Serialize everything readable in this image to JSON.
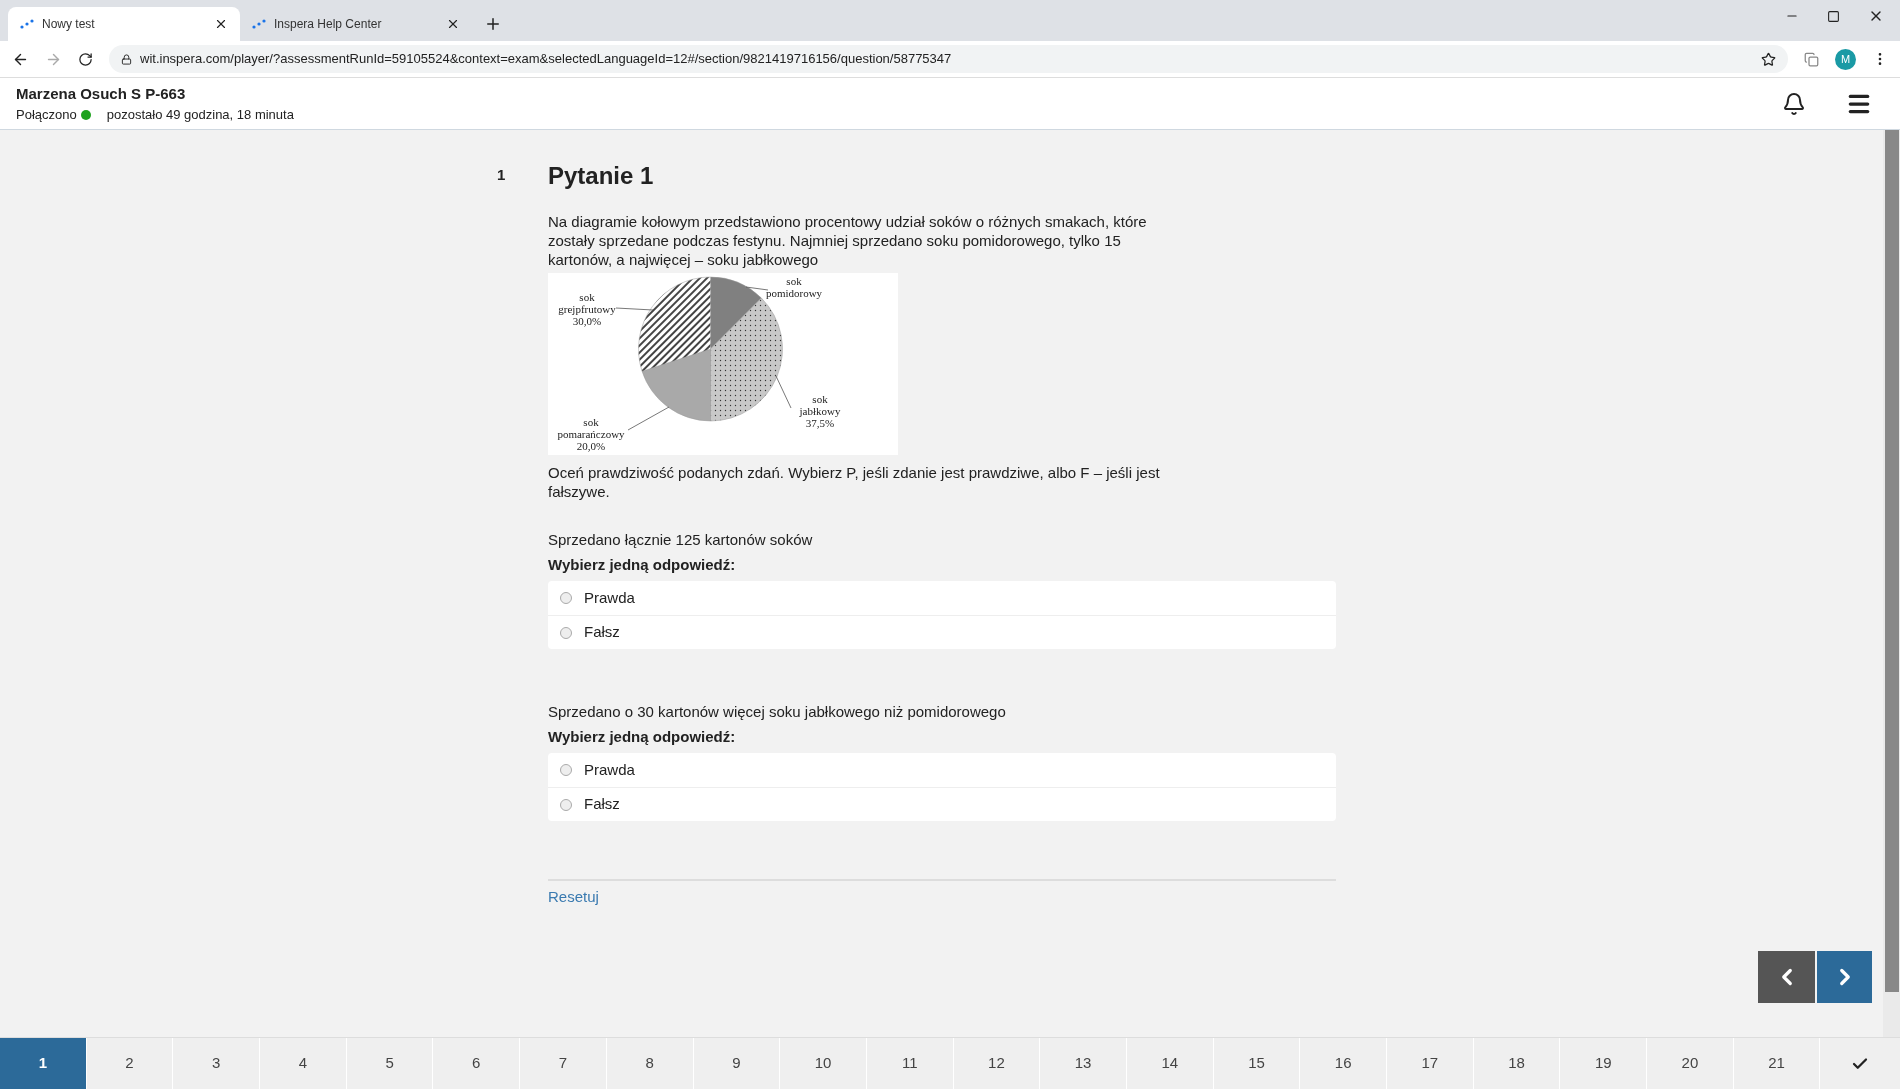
{
  "browser": {
    "tabs": [
      {
        "title": "Nowy test",
        "selected": true
      },
      {
        "title": "Inspera Help Center",
        "selected": false
      }
    ],
    "address": "wit.inspera.com/player/?assessmentRunId=59105524&context=exam&selectedLanguageId=12#/section/9821419716156/question/58775347",
    "profile_initial": "M"
  },
  "header": {
    "candidate": "Marzena Osuch S P-663",
    "connection": "Połączono",
    "connected": true,
    "time_left": "pozostało 49 godzina, 18 minuta"
  },
  "question": {
    "number": "1",
    "title": "Pytanie 1",
    "intro": "Na diagramie kołowym przedstawiono procentowy udział soków o różnych smakach, które zostały sprzedane podczas festynu. Najmniej sprzedano soku pomidorowego, tylko 15 kartonów, a najwięcej – soku jabłkowego",
    "chart_data": {
      "type": "pie",
      "categories": [
        "sok pomidorowy",
        "sok jabłkowy",
        "sok pomarańczowy",
        "sok grejpfrutowy"
      ],
      "values": [
        12.5,
        37.5,
        20,
        30
      ],
      "value_labels": [
        null,
        "37,5%",
        "20,0%",
        "30,0%"
      ]
    },
    "instruction": "Oceń prawdziwość podanych zdań. Wybierz P, jeśli zdanie jest prawdziwe, albo F – jeśli jest fałszywe.",
    "statements": [
      {
        "text": "Sprzedano łącznie 125 kartonów soków",
        "prompt": "Wybierz jedną odpowiedź:",
        "options": [
          {
            "label": "Prawda",
            "selected": false
          },
          {
            "label": "Fałsz",
            "selected": false
          }
        ]
      },
      {
        "text": "Sprzedano o 30 kartonów więcej soku jabłkowego niż pomidorowego",
        "prompt": "Wybierz jedną odpowiedź:",
        "options": [
          {
            "label": "Prawda",
            "selected": false
          },
          {
            "label": "Fałsz",
            "selected": false
          }
        ]
      }
    ],
    "reset": "Resetuj"
  },
  "pages": [
    {
      "label": "1",
      "selected": true
    },
    {
      "label": "2",
      "selected": false
    },
    {
      "label": "3",
      "selected": false
    },
    {
      "label": "4",
      "selected": false
    },
    {
      "label": "5",
      "selected": false
    },
    {
      "label": "6",
      "selected": false
    },
    {
      "label": "7",
      "selected": false
    },
    {
      "label": "8",
      "selected": false
    },
    {
      "label": "9",
      "selected": false
    },
    {
      "label": "10",
      "selected": false
    },
    {
      "label": "11",
      "selected": false
    },
    {
      "label": "12",
      "selected": false
    },
    {
      "label": "13",
      "selected": false
    },
    {
      "label": "14",
      "selected": false
    },
    {
      "label": "15",
      "selected": false
    },
    {
      "label": "16",
      "selected": false
    },
    {
      "label": "17",
      "selected": false
    },
    {
      "label": "18",
      "selected": false
    },
    {
      "label": "19",
      "selected": false
    },
    {
      "label": "20",
      "selected": false
    },
    {
      "label": "21",
      "selected": false
    }
  ]
}
